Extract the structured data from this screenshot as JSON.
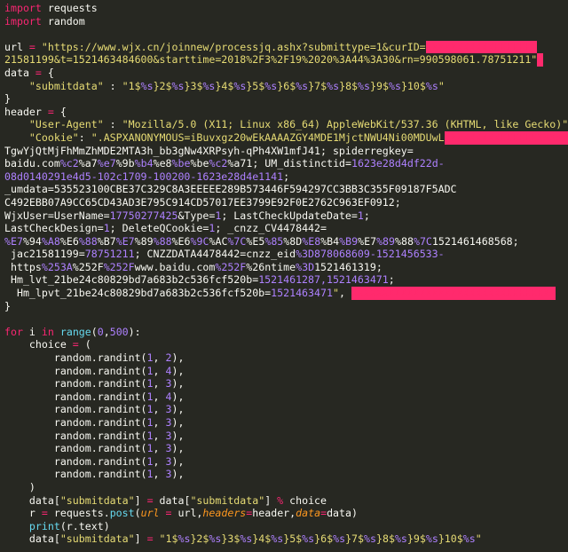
{
  "editor": {
    "background": "#272822",
    "redaction_color": "#ff2a6d",
    "lines": [
      [
        [
          "kw",
          "import"
        ],
        [
          "txt",
          " requests"
        ]
      ],
      [
        [
          "kw",
          "import"
        ],
        [
          "txt",
          " random"
        ]
      ],
      [],
      [
        [
          "txt",
          "url "
        ],
        [
          "op",
          "="
        ],
        [
          "txt",
          " "
        ],
        [
          "str",
          "\"https://www.wjx.cn/joinnew/processjq.ashx?submittype=1&curID="
        ],
        [
          "red",
          "XXXXXXXXXXXXXXXXXX"
        ]
      ],
      [
        [
          "str",
          "21581199&t=1521463484600&starttime=2018%2F3%2F19%2020%3A44%3A30&rn=990598061.78751211\""
        ],
        [
          "red",
          "X"
        ]
      ],
      [
        [
          "txt",
          "data "
        ],
        [
          "op",
          "="
        ],
        [
          "txt",
          " {"
        ]
      ],
      [
        [
          "txt",
          "    "
        ],
        [
          "str",
          "\"submitdata\""
        ],
        [
          "txt",
          " : "
        ],
        [
          "str",
          "\"1$"
        ],
        [
          "var",
          "%s"
        ],
        [
          "str",
          "}2$"
        ],
        [
          "var",
          "%s"
        ],
        [
          "str",
          "}3$"
        ],
        [
          "var",
          "%s"
        ],
        [
          "str",
          "}4$"
        ],
        [
          "var",
          "%s"
        ],
        [
          "str",
          "}5$"
        ],
        [
          "var",
          "%s"
        ],
        [
          "str",
          "}6$"
        ],
        [
          "var",
          "%s"
        ],
        [
          "str",
          "}7$"
        ],
        [
          "var",
          "%s"
        ],
        [
          "str",
          "}8$"
        ],
        [
          "var",
          "%s"
        ],
        [
          "str",
          "}9$"
        ],
        [
          "var",
          "%s"
        ],
        [
          "str",
          "}10$"
        ],
        [
          "var",
          "%s"
        ],
        [
          "str",
          "\""
        ]
      ],
      [
        [
          "txt",
          "}"
        ]
      ],
      [
        [
          "txt",
          "header "
        ],
        [
          "op",
          "="
        ],
        [
          "txt",
          " {"
        ]
      ],
      [
        [
          "txt",
          "    "
        ],
        [
          "str",
          "\"User-Agent\""
        ],
        [
          "txt",
          " : "
        ],
        [
          "str",
          "\"Mozilla/5.0 (X11; Linux x86_64) AppleWebKit/537.36 (KHTML, like Gecko)\""
        ],
        [
          "txt",
          ","
        ]
      ],
      [
        [
          "txt",
          "    "
        ],
        [
          "str",
          "\"Cookie\""
        ],
        [
          "txt",
          ": "
        ],
        [
          "str",
          "\".ASPXANONYMOUS=iBuvxgz20wEkAAAAZGY4MDE1MjctNWU4Ni00MDUwL"
        ],
        [
          "red",
          "XXXXXXXXXXXXXXXXXXXXXXXXX"
        ]
      ],
      [
        [
          "txt",
          "TgwYjQtMjFhMmZhMDE2MTA3h_bb3gNw4XRPsyh-qPh4XW1mfJ41; spiderregkey="
        ]
      ],
      [
        [
          "txt",
          "baidu.com"
        ],
        [
          "var",
          "%c2"
        ],
        [
          "txt",
          "%a7"
        ],
        [
          "var",
          "%e7"
        ],
        [
          "txt",
          "%9b"
        ],
        [
          "var",
          "%b4"
        ],
        [
          "txt",
          "%e8"
        ],
        [
          "var",
          "%be"
        ],
        [
          "txt",
          "%be"
        ],
        [
          "var",
          "%c2"
        ],
        [
          "txt",
          "%a71; UM_distinctid="
        ],
        [
          "num",
          "1623e28d4df22d-"
        ]
      ],
      [
        [
          "num",
          "08d0140291e4d5-102c1709-100200-1623e28d4e1141"
        ],
        [
          "txt",
          ";"
        ]
      ],
      [
        [
          "txt",
          "_umdata=535523100CBE37C329C8A3EEEEE289B573446F594297CC3BB3C355F09187F5ADC"
        ]
      ],
      [
        [
          "txt",
          "C492EBB07A9CC65CD43AD3E795C914CD57017EE3799E92F0E2762C963EF0912;"
        ]
      ],
      [
        [
          "txt",
          "WjxUser=UserName="
        ],
        [
          "num",
          "17750277425"
        ],
        [
          "txt",
          "&Type="
        ],
        [
          "num",
          "1"
        ],
        [
          "txt",
          "; LastCheckUpdateDate="
        ],
        [
          "num",
          "1"
        ],
        [
          "txt",
          ";"
        ]
      ],
      [
        [
          "txt",
          "LastCheckDesign="
        ],
        [
          "num",
          "1"
        ],
        [
          "txt",
          "; DeleteQCookie="
        ],
        [
          "num",
          "1"
        ],
        [
          "txt",
          "; _cnzz_CV4478442="
        ]
      ],
      [
        [
          "var",
          "%E7"
        ],
        [
          "txt",
          "%94"
        ],
        [
          "var",
          "%A8"
        ],
        [
          "txt",
          "%E6"
        ],
        [
          "var",
          "%88"
        ],
        [
          "txt",
          "%B7"
        ],
        [
          "var",
          "%E7"
        ],
        [
          "txt",
          "%89"
        ],
        [
          "var",
          "%88"
        ],
        [
          "txt",
          "%E6"
        ],
        [
          "var",
          "%9C"
        ],
        [
          "txt",
          "%AC"
        ],
        [
          "var",
          "%7C"
        ],
        [
          "txt",
          "%E5"
        ],
        [
          "var",
          "%85"
        ],
        [
          "txt",
          "%8D"
        ],
        [
          "var",
          "%E8"
        ],
        [
          "txt",
          "%B4"
        ],
        [
          "var",
          "%B9"
        ],
        [
          "txt",
          "%E7"
        ],
        [
          "var",
          "%89"
        ],
        [
          "txt",
          "%88"
        ],
        [
          "var",
          "%7C"
        ],
        [
          "txt",
          "1521461468568;"
        ]
      ],
      [
        [
          "txt",
          " jac21581199="
        ],
        [
          "num",
          "78751211"
        ],
        [
          "txt",
          "; CNZZDATA4478442=cnzz_eid"
        ],
        [
          "var",
          "%3D"
        ],
        [
          "num",
          "878068609-1521456533-"
        ]
      ],
      [
        [
          "txt",
          " https"
        ],
        [
          "var",
          "%253A"
        ],
        [
          "txt",
          "%252F"
        ],
        [
          "var",
          "%252F"
        ],
        [
          "txt",
          "www.baidu.com"
        ],
        [
          "var",
          "%252F"
        ],
        [
          "txt",
          "%26ntime"
        ],
        [
          "var",
          "%3D"
        ],
        [
          "txt",
          "1521461319;"
        ]
      ],
      [
        [
          "txt",
          " Hm_lvt_21be24c80829bd7a683b2c536fcf520b="
        ],
        [
          "num",
          "1521461287,1521463471"
        ],
        [
          "txt",
          ";"
        ]
      ],
      [
        [
          "txt",
          "  Hm_lpvt_21be24c80829bd7a683b2c536fcf520b="
        ],
        [
          "num",
          "1521463471"
        ],
        [
          "str",
          "\""
        ],
        [
          "txt",
          ", "
        ],
        [
          "red",
          "XXXXXXXXXXXXXXXXXXXXXXXXXXXXXXXXX"
        ]
      ],
      [
        [
          "txt",
          "}"
        ]
      ],
      [],
      [
        [
          "kw",
          "for"
        ],
        [
          "txt",
          " i "
        ],
        [
          "kw",
          "in"
        ],
        [
          "txt",
          " "
        ],
        [
          "fn",
          "range"
        ],
        [
          "txt",
          "("
        ],
        [
          "num",
          "0"
        ],
        [
          "txt",
          ","
        ],
        [
          "num",
          "500"
        ],
        [
          "txt",
          "):"
        ]
      ],
      [
        [
          "txt",
          "    choice "
        ],
        [
          "op",
          "="
        ],
        [
          "txt",
          " ("
        ]
      ],
      [
        [
          "txt",
          "        random.randint("
        ],
        [
          "num",
          "1"
        ],
        [
          "txt",
          ", "
        ],
        [
          "num",
          "2"
        ],
        [
          "txt",
          "),"
        ]
      ],
      [
        [
          "txt",
          "        random.randint("
        ],
        [
          "num",
          "1"
        ],
        [
          "txt",
          ", "
        ],
        [
          "num",
          "4"
        ],
        [
          "txt",
          "),"
        ]
      ],
      [
        [
          "txt",
          "        random.randint("
        ],
        [
          "num",
          "1"
        ],
        [
          "txt",
          ", "
        ],
        [
          "num",
          "3"
        ],
        [
          "txt",
          "),"
        ]
      ],
      [
        [
          "txt",
          "        random.randint("
        ],
        [
          "num",
          "1"
        ],
        [
          "txt",
          ", "
        ],
        [
          "num",
          "4"
        ],
        [
          "txt",
          "),"
        ]
      ],
      [
        [
          "txt",
          "        random.randint("
        ],
        [
          "num",
          "1"
        ],
        [
          "txt",
          ", "
        ],
        [
          "num",
          "3"
        ],
        [
          "txt",
          "),"
        ]
      ],
      [
        [
          "txt",
          "        random.randint("
        ],
        [
          "num",
          "1"
        ],
        [
          "txt",
          ", "
        ],
        [
          "num",
          "3"
        ],
        [
          "txt",
          "),"
        ]
      ],
      [
        [
          "txt",
          "        random.randint("
        ],
        [
          "num",
          "1"
        ],
        [
          "txt",
          ", "
        ],
        [
          "num",
          "3"
        ],
        [
          "txt",
          "),"
        ]
      ],
      [
        [
          "txt",
          "        random.randint("
        ],
        [
          "num",
          "1"
        ],
        [
          "txt",
          ", "
        ],
        [
          "num",
          "3"
        ],
        [
          "txt",
          "),"
        ]
      ],
      [
        [
          "txt",
          "        random.randint("
        ],
        [
          "num",
          "1"
        ],
        [
          "txt",
          ", "
        ],
        [
          "num",
          "3"
        ],
        [
          "txt",
          "),"
        ]
      ],
      [
        [
          "txt",
          "        random.randint("
        ],
        [
          "num",
          "1"
        ],
        [
          "txt",
          ", "
        ],
        [
          "num",
          "3"
        ],
        [
          "txt",
          "),"
        ]
      ],
      [
        [
          "txt",
          "    )"
        ]
      ],
      [
        [
          "txt",
          "    data["
        ],
        [
          "str",
          "\"submitdata\""
        ],
        [
          "txt",
          "] "
        ],
        [
          "op",
          "="
        ],
        [
          "txt",
          " data["
        ],
        [
          "str",
          "\"submitdata\""
        ],
        [
          "txt",
          "] "
        ],
        [
          "op",
          "%"
        ],
        [
          "txt",
          " choice"
        ]
      ],
      [
        [
          "txt",
          "    r "
        ],
        [
          "op",
          "="
        ],
        [
          "txt",
          " requests."
        ],
        [
          "fn",
          "post"
        ],
        [
          "txt",
          "("
        ],
        [
          "arg",
          "url"
        ],
        [
          "txt",
          " "
        ],
        [
          "op",
          "="
        ],
        [
          "txt",
          " url,"
        ],
        [
          "arg",
          "headers"
        ],
        [
          "op",
          "="
        ],
        [
          "txt",
          "header,"
        ],
        [
          "arg",
          "data"
        ],
        [
          "op",
          "="
        ],
        [
          "txt",
          "data)"
        ]
      ],
      [
        [
          "txt",
          "    "
        ],
        [
          "fn",
          "print"
        ],
        [
          "txt",
          "(r.text)"
        ]
      ],
      [
        [
          "txt",
          "    data["
        ],
        [
          "str",
          "\"submitdata\""
        ],
        [
          "txt",
          "] "
        ],
        [
          "op",
          "="
        ],
        [
          "txt",
          " "
        ],
        [
          "str",
          "\"1$"
        ],
        [
          "var",
          "%s"
        ],
        [
          "str",
          "}2$"
        ],
        [
          "var",
          "%s"
        ],
        [
          "str",
          "}3$"
        ],
        [
          "var",
          "%s"
        ],
        [
          "str",
          "}4$"
        ],
        [
          "var",
          "%s"
        ],
        [
          "str",
          "}5$"
        ],
        [
          "var",
          "%s"
        ],
        [
          "str",
          "}6$"
        ],
        [
          "var",
          "%s"
        ],
        [
          "str",
          "}7$"
        ],
        [
          "var",
          "%s"
        ],
        [
          "str",
          "}8$"
        ],
        [
          "var",
          "%s"
        ],
        [
          "str",
          "}9$"
        ],
        [
          "var",
          "%s"
        ],
        [
          "str",
          "}10$"
        ],
        [
          "var",
          "%s"
        ],
        [
          "str",
          "\""
        ]
      ]
    ]
  }
}
